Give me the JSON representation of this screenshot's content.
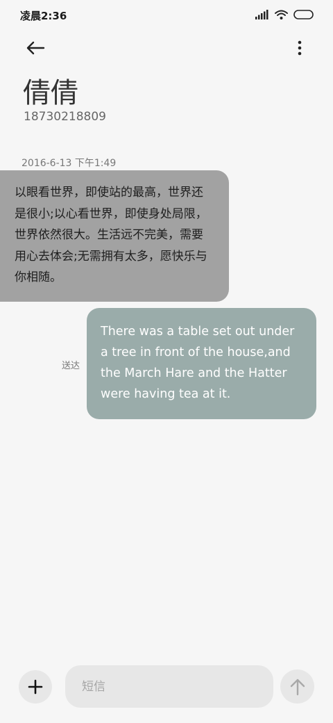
{
  "status_bar": {
    "time": "凌晨2:36",
    "icons": [
      "signal-icon",
      "wifi-icon",
      "battery-icon"
    ]
  },
  "toolbar": {
    "back_icon": "arrow-left-icon",
    "more_icon": "more-vertical-icon"
  },
  "contact": {
    "name": "倩倩",
    "phone": "18730218809"
  },
  "conversation": {
    "timestamp": "2016-6-13 下午1:49",
    "messages": [
      {
        "direction": "incoming",
        "text": "以眼看世界，即使站的最高，世界还是很小;以心看世界，即使身处局限，世界依然很大。生活远不完美，需要用心去体会;无需拥有太多，愿快乐与你相随。"
      },
      {
        "direction": "outgoing",
        "text": "There was a table set out under a tree in front of the house,and the March Hare and the Hatter were having tea at it.",
        "status": "送达"
      }
    ]
  },
  "composer": {
    "add_icon": "plus-icon",
    "placeholder": "短信",
    "send_icon": "arrow-up-icon"
  },
  "colors": {
    "background": "#f6f6f6",
    "incoming_bubble": "#a2a2a2",
    "outgoing_bubble": "#9aacaa",
    "button_bg": "#e7e7e7"
  }
}
